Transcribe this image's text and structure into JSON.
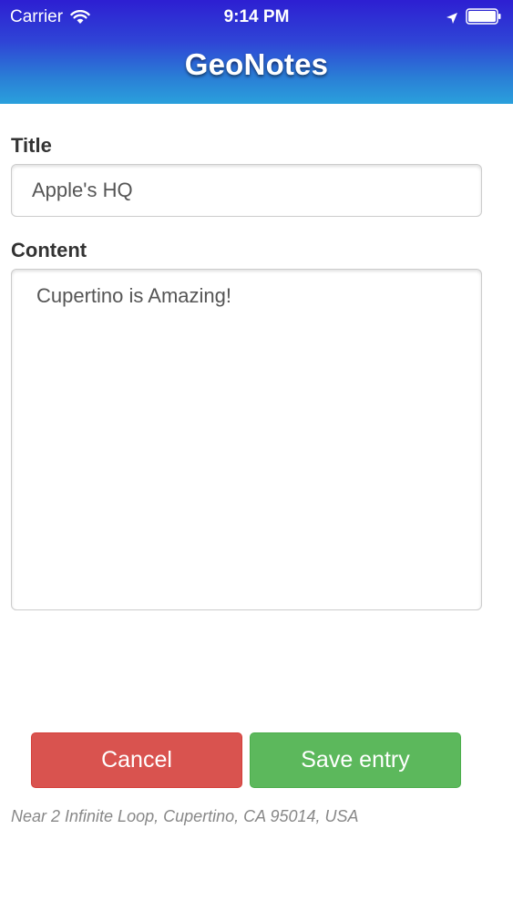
{
  "status_bar": {
    "carrier": "Carrier",
    "time": "9:14 PM"
  },
  "header": {
    "title": "GeoNotes"
  },
  "form": {
    "title_label": "Title",
    "title_value": "Apple's HQ",
    "content_label": "Content",
    "content_value": "Cupertino is Amazing!"
  },
  "actions": {
    "cancel_label": "Cancel",
    "save_label": "Save entry"
  },
  "location": {
    "text": "Near 2 Infinite Loop, Cupertino, CA 95014, USA"
  },
  "colors": {
    "header_top": "#2d1fd2",
    "header_bottom": "#2aa0dc",
    "cancel": "#d9534f",
    "save": "#5cb85c"
  }
}
